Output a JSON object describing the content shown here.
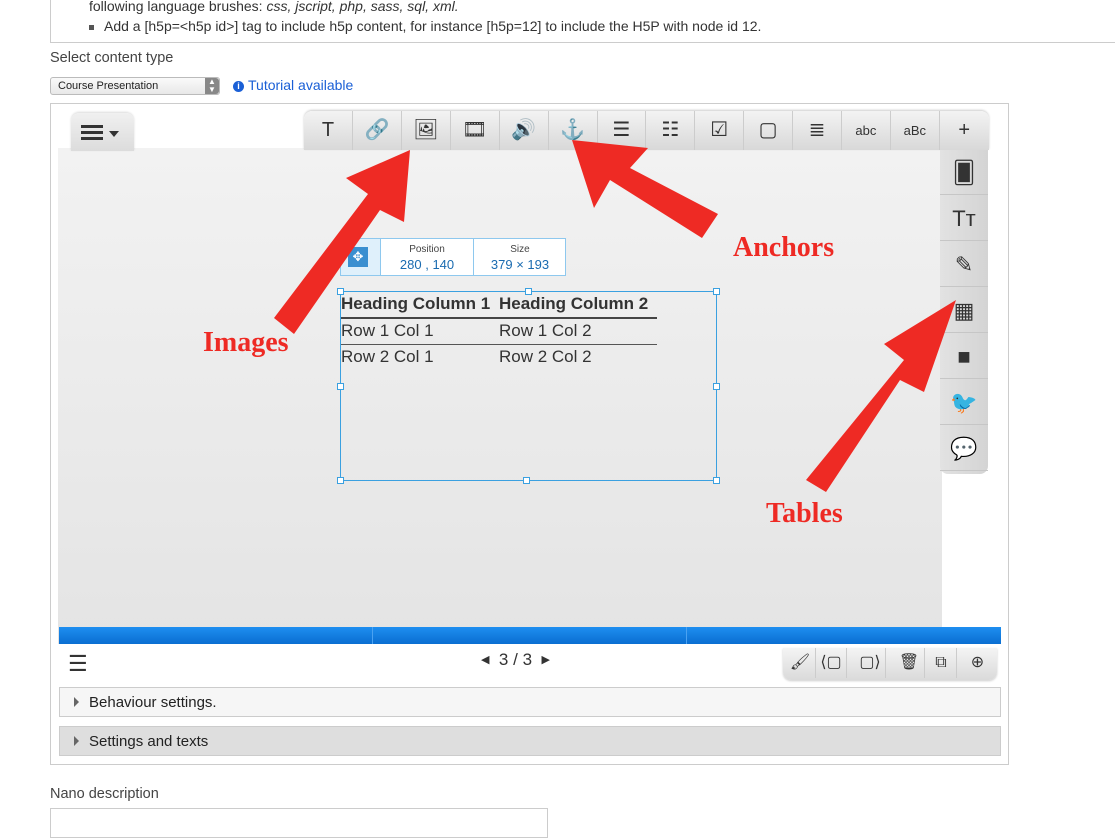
{
  "help": {
    "line1_prefix": "following language brushes: ",
    "line1_langs": "css, jscript, php, sass, sql, xml.",
    "line2": "Add a [h5p=<h5p id>] tag to include h5p content, for instance [h5p=12] to include the H5P with node id 12."
  },
  "content_type": {
    "label": "Select content type",
    "selected": "Course Presentation",
    "tutorial": "Tutorial available"
  },
  "toolbar": {
    "buttons": [
      {
        "name": "text",
        "glyph": "T"
      },
      {
        "name": "link",
        "glyph": "🔗"
      },
      {
        "name": "image",
        "glyph": "🖼"
      },
      {
        "name": "video",
        "glyph": "🎞"
      },
      {
        "name": "audio",
        "glyph": "🔊"
      },
      {
        "name": "anchor",
        "glyph": "⚓"
      },
      {
        "name": "fill-blanks",
        "glyph": "☰"
      },
      {
        "name": "multichoice",
        "glyph": "☷"
      },
      {
        "name": "true-false",
        "glyph": "☑"
      },
      {
        "name": "dialog",
        "glyph": "▢"
      },
      {
        "name": "list",
        "glyph": "≣"
      },
      {
        "name": "drag-text",
        "glyph": "abc"
      },
      {
        "name": "mark-words",
        "glyph": "aBc"
      },
      {
        "name": "more",
        "glyph": "+"
      }
    ]
  },
  "sidebar": {
    "buttons": [
      {
        "name": "flashcards",
        "glyph": "🂠"
      },
      {
        "name": "font",
        "glyph": "Tт"
      },
      {
        "name": "edit-area",
        "glyph": "✎"
      },
      {
        "name": "table",
        "glyph": "▦"
      },
      {
        "name": "video-camera",
        "glyph": "■"
      },
      {
        "name": "twitter",
        "glyph": "🐦"
      },
      {
        "name": "chat",
        "glyph": "💬"
      }
    ]
  },
  "element": {
    "position_label": "Position",
    "position_x": "280",
    "position_sep": ",",
    "position_y": "140",
    "size_label": "Size",
    "size_value": "379 × 193",
    "table": {
      "headers": [
        "Heading Column 1",
        "Heading Column 2"
      ],
      "rows": [
        [
          "Row 1 Col 1",
          "Row 1 Col 2"
        ],
        [
          "Row 2 Col 1",
          "Row 2 Col 2"
        ]
      ]
    }
  },
  "pager": {
    "current": "3",
    "sep": "/",
    "total": "3"
  },
  "accordions": {
    "behaviour": "Behaviour settings.",
    "settings": "Settings and texts"
  },
  "nano": {
    "label": "Nano description"
  },
  "annotations": {
    "images": "Images",
    "anchors": "Anchors",
    "tables": "Tables",
    "color": "#ee2a24"
  }
}
